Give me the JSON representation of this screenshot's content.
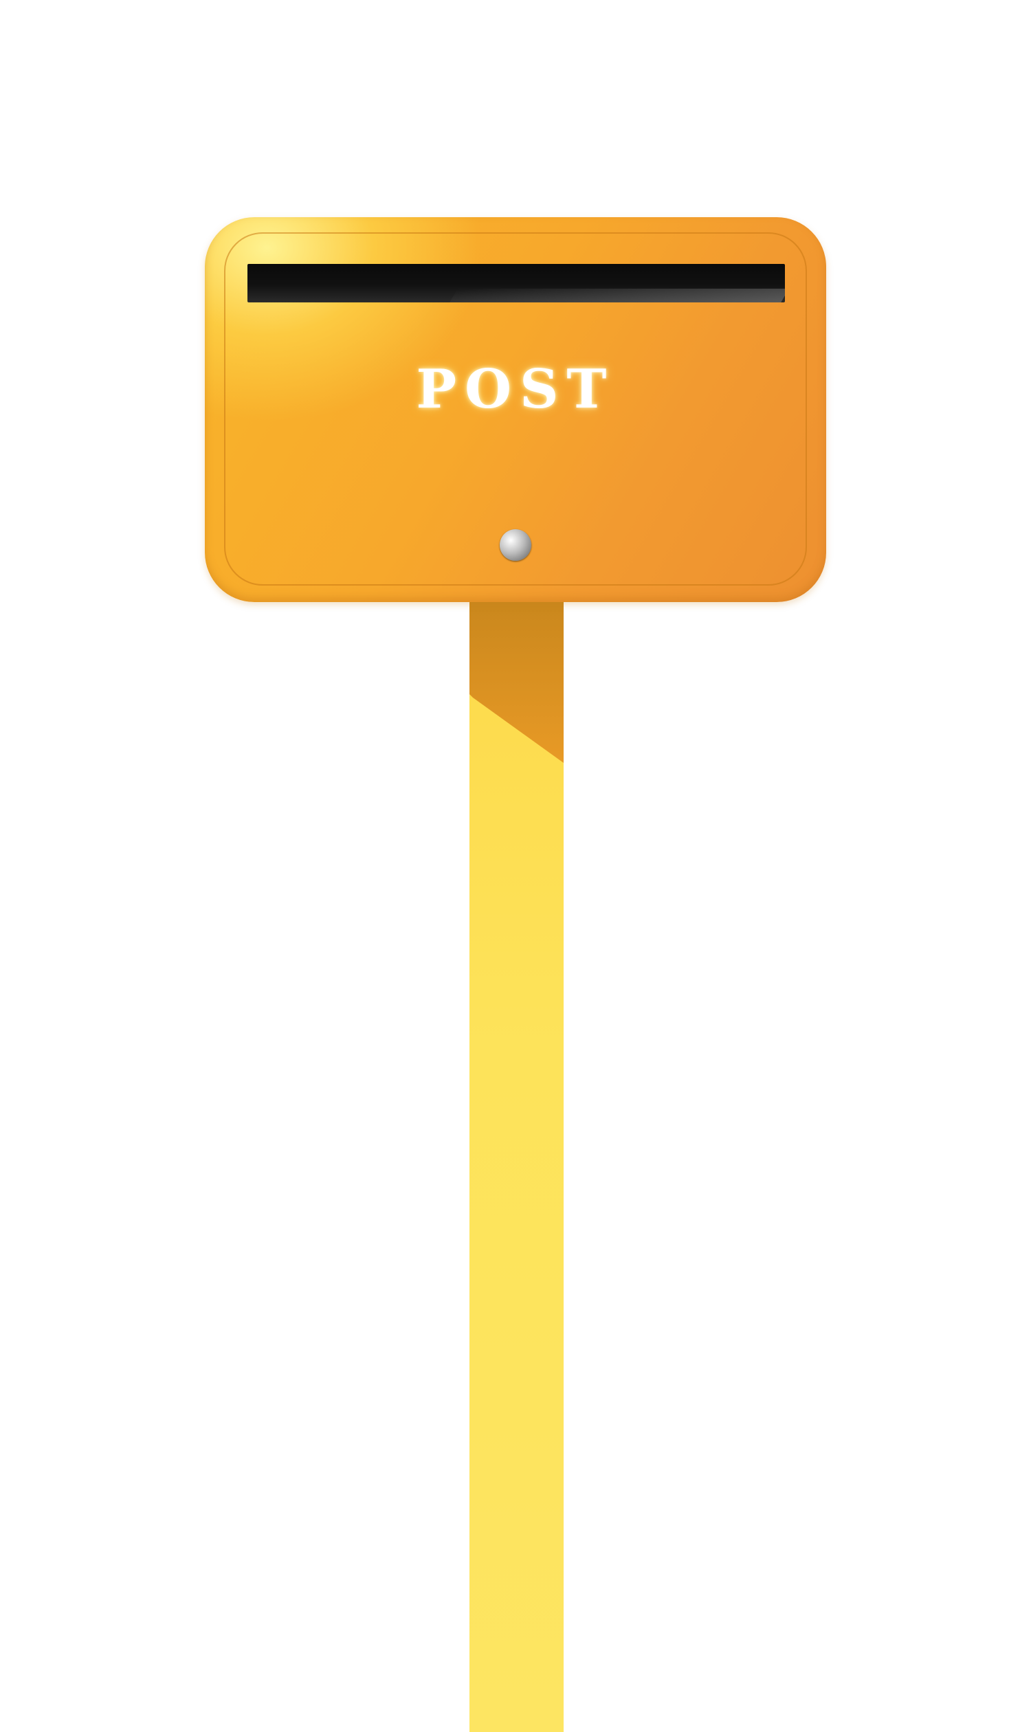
{
  "mailbox": {
    "label": "POST"
  },
  "colors": {
    "box": "#f7a82c",
    "pole": "#fde35a",
    "slot": "#111111"
  },
  "icons": {
    "lock": "lock-icon"
  }
}
